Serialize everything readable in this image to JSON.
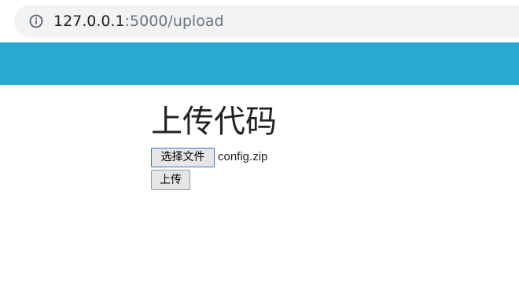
{
  "browser": {
    "url_host": "127.0.0.1",
    "url_path": ":5000/upload",
    "info_icon": "info-icon"
  },
  "navbar": {
    "color": "#2aa8d4"
  },
  "main": {
    "title": "上传代码",
    "choose_file_label": "选择文件",
    "selected_file": "config.zip",
    "upload_label": "上传"
  }
}
